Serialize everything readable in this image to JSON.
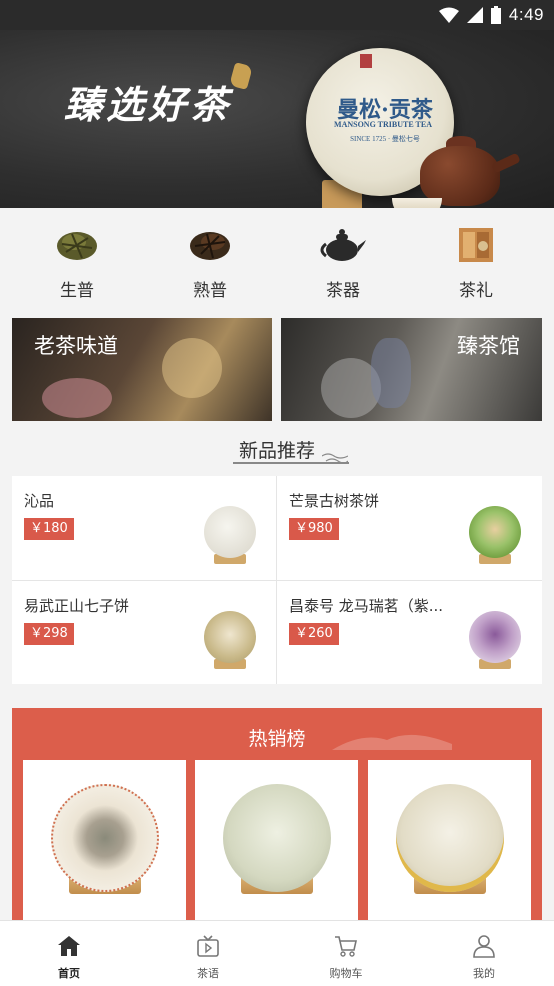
{
  "status_bar": {
    "time": "4:49"
  },
  "banner": {
    "title": "臻选好茶",
    "cake_name_cn": "曼松·贡茶",
    "cake_name_en": "MANSONG TRIBUTE TEA",
    "cake_since": "SINCE 1725 · 曼松七号"
  },
  "categories": [
    {
      "label": "生普",
      "icon": "loose-tea-icon"
    },
    {
      "label": "熟普",
      "icon": "dark-tea-icon"
    },
    {
      "label": "茶器",
      "icon": "teapot-icon"
    },
    {
      "label": "茶礼",
      "icon": "gift-box-icon"
    }
  ],
  "promos": [
    {
      "label": "老茶味道"
    },
    {
      "label": "臻茶馆"
    }
  ],
  "new_products": {
    "title": "新品推荐",
    "items": [
      {
        "name": "沁品",
        "price": "￥180",
        "accent": "#c94a4a"
      },
      {
        "name": "芒景古树茶饼",
        "price": "￥980",
        "accent": "#5a8a3a"
      },
      {
        "name": "易武正山七子饼",
        "price": "￥298",
        "accent": "#9a7a3a"
      },
      {
        "name": "昌泰号 龙马瑞茗（紫...",
        "price": "￥260",
        "accent": "#7a4a8a"
      }
    ]
  },
  "hot": {
    "title": "热销榜"
  },
  "tabbar": {
    "items": [
      {
        "label": "首页",
        "icon": "home-icon",
        "active": true
      },
      {
        "label": "茶语",
        "icon": "video-icon",
        "active": false
      },
      {
        "label": "购物车",
        "icon": "cart-icon",
        "active": false
      },
      {
        "label": "我的",
        "icon": "user-icon",
        "active": false
      }
    ]
  },
  "colors": {
    "accent_red": "#dc5e4b",
    "price_red": "#d9594a"
  }
}
